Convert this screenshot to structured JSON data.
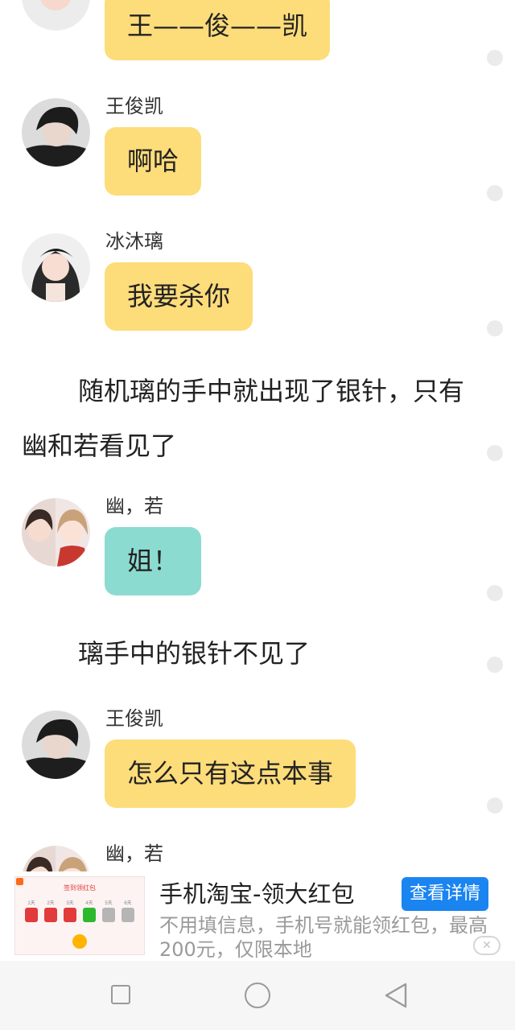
{
  "messages": [
    {
      "type": "bubble",
      "text": "王——俊——凯",
      "color": "yellow"
    },
    {
      "type": "bubble",
      "name": "王俊凯",
      "text": "啊哈",
      "color": "yellow"
    },
    {
      "type": "bubble",
      "name": "冰沐璃",
      "text": "我要杀你",
      "color": "yellow"
    },
    {
      "type": "narration",
      "text": "随机璃的手中就出现了银针，只有幽和若看见了"
    },
    {
      "type": "bubble",
      "name": "幽，若",
      "text": "姐！",
      "color": "teal"
    },
    {
      "type": "narration",
      "text": "璃手中的银针不见了"
    },
    {
      "type": "bubble",
      "name": "王俊凯",
      "text": "怎么只有这点本事",
      "color": "yellow"
    },
    {
      "type": "bubble",
      "name": "幽，若"
    }
  ],
  "ad": {
    "title": "手机淘宝-领大红包",
    "button": "查看详情",
    "description": "不用填信息，手机号就能领红包，最高200元，仅限本地",
    "thumb_title": "签到领红包",
    "thumb_days": [
      "1天",
      "2天",
      "3天",
      "4天",
      "5天",
      "6天"
    ],
    "close_icon": "close-icon"
  },
  "colors": {
    "bubble_yellow": "#fddc7a",
    "bubble_teal": "#8cdbd0",
    "ad_button": "#1a84f0"
  },
  "navbar": {
    "icons": [
      "recent-apps-icon",
      "home-icon",
      "back-icon"
    ]
  }
}
